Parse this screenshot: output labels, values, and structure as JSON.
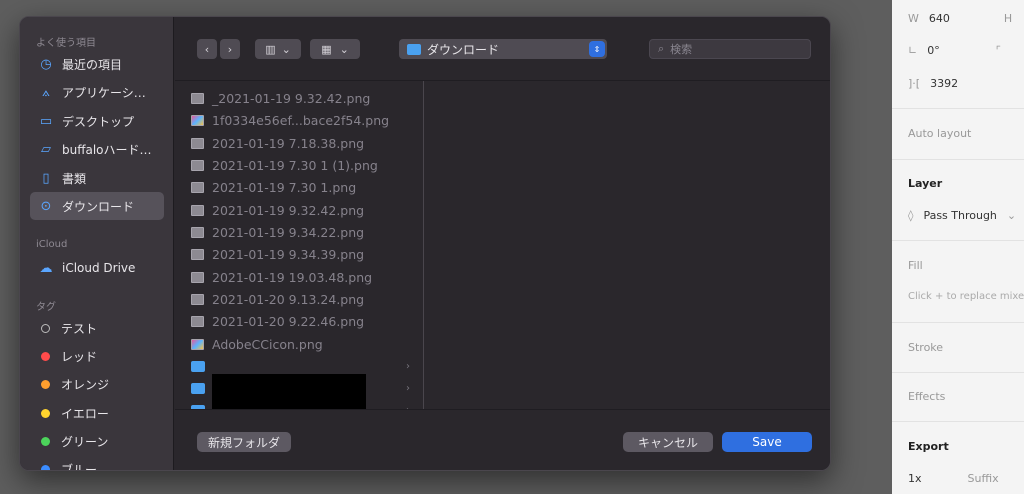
{
  "props_panel": {
    "w_label": "W",
    "w_value": "640",
    "h_label": "H",
    "rotation_value": "0°",
    "spacing_value": "3392",
    "auto_layout": "Auto layout",
    "layer_title": "Layer",
    "blend_mode": "Pass Through",
    "fill_title": "Fill",
    "fill_hint": "Click + to replace mixe",
    "stroke_title": "Stroke",
    "effects_title": "Effects",
    "export_title": "Export",
    "export_scale": "1x",
    "export_suffix": "Suffix"
  },
  "sidebar": {
    "favorites_header": "よく使う項目",
    "favorites": [
      {
        "label": "最近の項目",
        "icon": "clock-icon"
      },
      {
        "label": "アプリケーシ…",
        "icon": "applications-icon"
      },
      {
        "label": "デスクトップ",
        "icon": "desktop-icon"
      },
      {
        "label": "buffaloハード…",
        "icon": "folder-icon"
      },
      {
        "label": "書類",
        "icon": "document-icon"
      },
      {
        "label": "ダウンロード",
        "icon": "download-icon",
        "selected": true
      }
    ],
    "icloud_header": "iCloud",
    "icloud_drive": "iCloud Drive",
    "tags_header": "タグ",
    "tags": [
      {
        "label": "テスト",
        "color": ""
      },
      {
        "label": "レッド",
        "color": "#ff4b4b"
      },
      {
        "label": "オレンジ",
        "color": "#ff9f2e"
      },
      {
        "label": "イエロー",
        "color": "#ffd42e"
      },
      {
        "label": "グリーン",
        "color": "#4cd45b"
      },
      {
        "label": "ブルー",
        "color": "#3b8cff"
      }
    ]
  },
  "toolbar": {
    "location": "ダウンロード",
    "search_placeholder": "検索"
  },
  "files": [
    {
      "name": "_2021-01-19 9.32.42.png",
      "icon": "image-file-icon"
    },
    {
      "name": "1f0334e56ef...bace2f54.png",
      "icon": "image-file-color-icon"
    },
    {
      "name": "2021-01-19 7.18.38.png",
      "icon": "image-file-icon"
    },
    {
      "name": "2021-01-19 7.30 1 (1).png",
      "icon": "image-file-icon"
    },
    {
      "name": "2021-01-19 7.30 1.png",
      "icon": "image-file-icon"
    },
    {
      "name": "2021-01-19 9.32.42.png",
      "icon": "image-file-icon"
    },
    {
      "name": "2021-01-19 9.34.22.png",
      "icon": "image-file-icon"
    },
    {
      "name": "2021-01-19 9.34.39.png",
      "icon": "image-file-icon"
    },
    {
      "name": "2021-01-19 19.03.48.png",
      "icon": "image-file-icon"
    },
    {
      "name": "2021-01-20 9.13.24.png",
      "icon": "image-file-icon"
    },
    {
      "name": "2021-01-20 9.22.46.png",
      "icon": "image-file-icon"
    },
    {
      "name": "AdobeCCicon.png",
      "icon": "image-file-color-icon"
    }
  ],
  "bottom": {
    "new_folder": "新規フォルダ",
    "cancel": "キャンセル",
    "save": "Save"
  },
  "colors": {
    "accent": "#2f6fe0",
    "dialog_bg": "#2a272c",
    "sidebar_bg": "#3a363c"
  }
}
